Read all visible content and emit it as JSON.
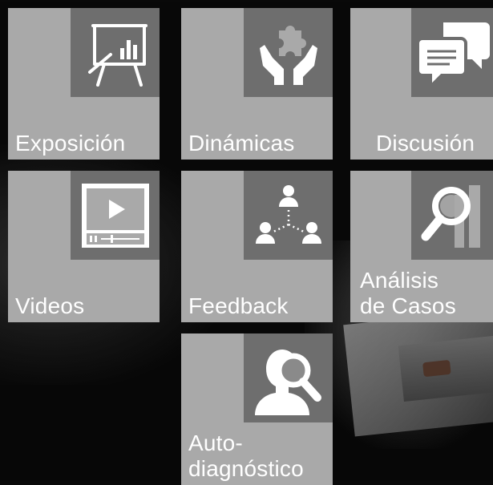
{
  "tiles": [
    {
      "key": "exposicion",
      "label": "Exposición",
      "icon": "presentation-board-icon"
    },
    {
      "key": "dinamicas",
      "label": "Dinámicas",
      "icon": "hands-puzzle-icon"
    },
    {
      "key": "discusion",
      "label": "Discusión",
      "icon": "chat-bubbles-icon"
    },
    {
      "key": "videos",
      "label": "Videos",
      "icon": "video-player-icon"
    },
    {
      "key": "feedback",
      "label": "Feedback",
      "icon": "people-network-icon"
    },
    {
      "key": "analisis",
      "label": "Análisis\nde Casos",
      "icon": "magnifier-document-icon"
    },
    {
      "key": "autodiagnostico",
      "label": "Auto-\ndiagnóstico",
      "icon": "person-magnifier-icon"
    }
  ],
  "colors": {
    "tile": "#a9a9a9",
    "icon_box": "#6e6e6e",
    "text": "#ffffff"
  }
}
